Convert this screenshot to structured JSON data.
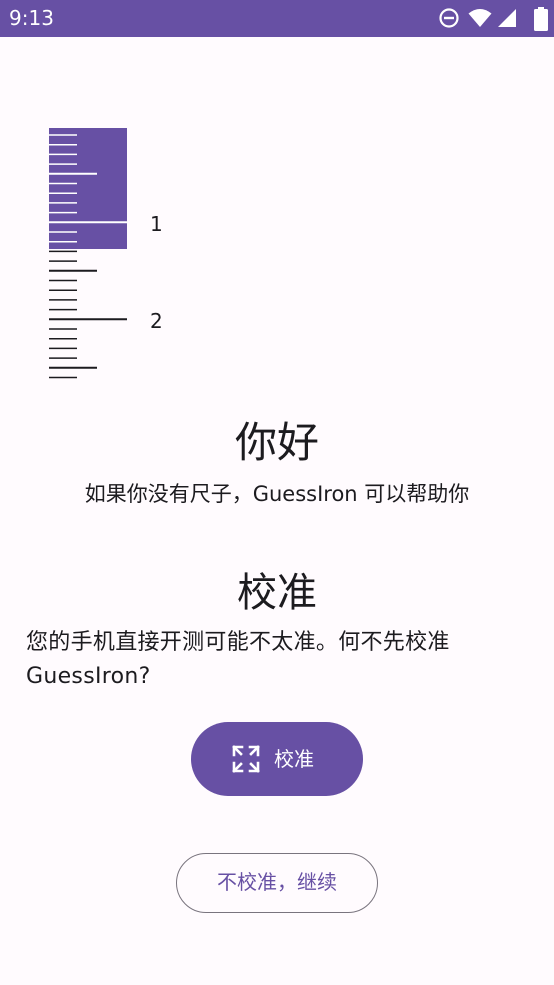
{
  "status_bar": {
    "time": "9:13",
    "icons": [
      "do-not-disturb-icon",
      "wifi-icon",
      "cellular-signal-icon",
      "battery-icon"
    ]
  },
  "ruler": {
    "labels": [
      "1",
      "2"
    ],
    "highlight_color": "#6750a4"
  },
  "greeting": {
    "title": "你好",
    "subtitle": "如果你没有尺子，GuessIron 可以帮助你"
  },
  "calibration": {
    "title": "校准",
    "description": "您的手机直接开测可能不太准。何不先校准 GuessIron?"
  },
  "buttons": {
    "calibrate_label": "校准",
    "calibrate_icon": "fullscreen-expand-icon",
    "skip_label": "不校准，继续"
  },
  "colors": {
    "primary": "#6750a4",
    "background": "#fffbfe",
    "on_surface": "#1c1b1f",
    "outline": "#79747e"
  }
}
